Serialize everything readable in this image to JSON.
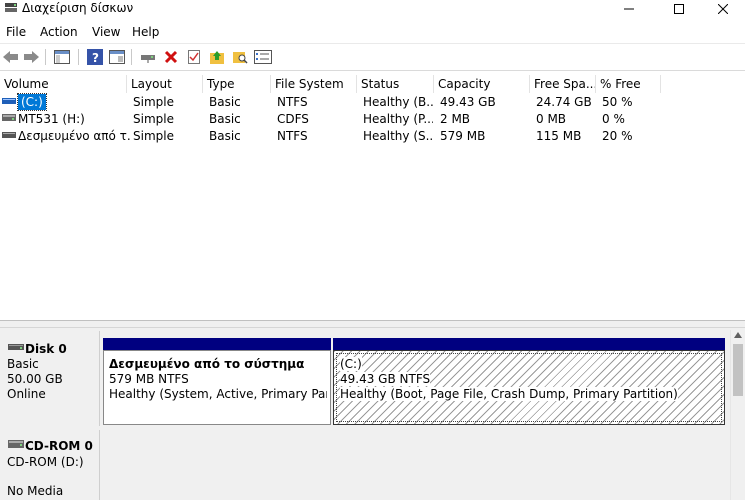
{
  "window": {
    "title": "Διαχείριση δίσκων",
    "minimize_icon": "minimize-icon",
    "maximize_icon": "maximize-icon",
    "close_icon": "close-icon"
  },
  "menu": {
    "file": "File",
    "action": "Action",
    "view": "View",
    "help": "Help"
  },
  "toolbar": {
    "icons": [
      "back-arrow-icon",
      "forward-arrow-icon",
      "console-tree-icon",
      "help-icon",
      "properties-icon",
      "connect-drive-icon",
      "delete-icon",
      "check-icon",
      "folder-up-icon",
      "search-folder-icon",
      "settings-list-icon"
    ]
  },
  "volumes": {
    "headers": [
      "Volume",
      "Layout",
      "Type",
      "File System",
      "Status",
      "Capacity",
      "Free Spa...",
      "% Free"
    ],
    "rows": [
      {
        "volume": "(C:)",
        "layout": "Simple",
        "type": "Basic",
        "fs": "NTFS",
        "status": "Healthy (B...",
        "capacity": "49.43 GB",
        "free": "24.74 GB",
        "pct": "50 %"
      },
      {
        "volume": "MT531 (H:)",
        "layout": "Simple",
        "type": "Basic",
        "fs": "CDFS",
        "status": "Healthy (P...",
        "capacity": "2 MB",
        "free": "0 MB",
        "pct": "0 %"
      },
      {
        "volume": "Δεσμευμένο από τ...",
        "layout": "Simple",
        "type": "Basic",
        "fs": "NTFS",
        "status": "Healthy (S...",
        "capacity": "579 MB",
        "free": "115 MB",
        "pct": "20 %"
      }
    ]
  },
  "disks": {
    "disk0": {
      "name": "Disk 0",
      "type": "Basic",
      "size": "50.00 GB",
      "state": "Online",
      "partitions": [
        {
          "name": "Δεσμευμένο από το σύστημα",
          "size": "579 MB NTFS",
          "status": "Healthy (System, Active, Primary Partition)"
        },
        {
          "name": "(C:)",
          "size": "49.43 GB NTFS",
          "status": "Healthy (Boot, Page File, Crash Dump, Primary Partition)"
        }
      ]
    },
    "cdrom0": {
      "name": "CD-ROM 0",
      "type": "CD-ROM (D:)",
      "state": "No Media"
    }
  },
  "colors": {
    "partition_stripe": "#000080",
    "selection": "#0078d7",
    "pane_bg": "#f0f0f0"
  }
}
